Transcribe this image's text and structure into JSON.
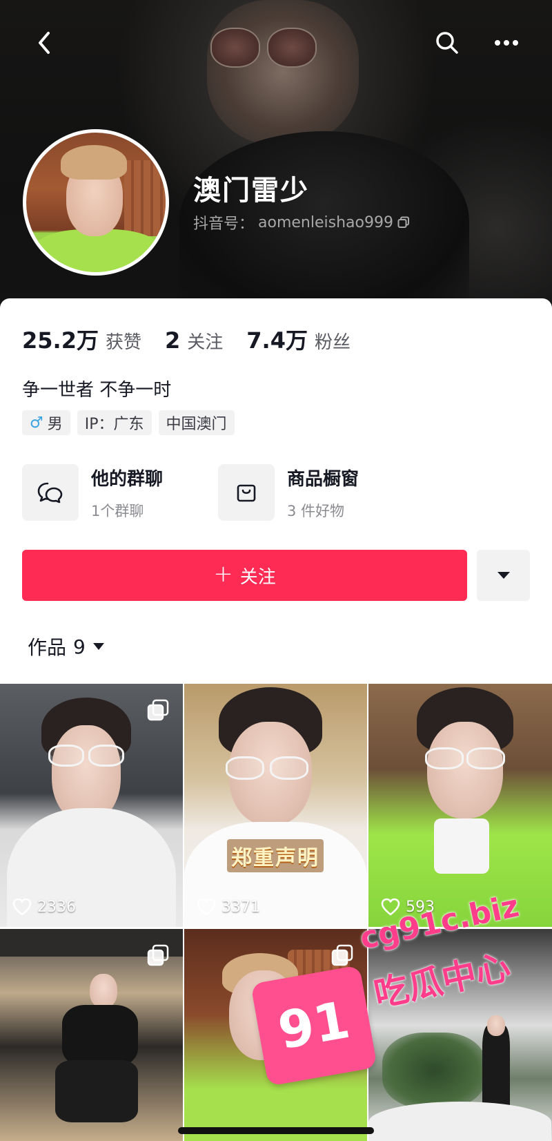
{
  "profile": {
    "name": "澳门雷少",
    "uid_label": "抖音号：",
    "uid": "aomenleishao999",
    "bio": "争一世者 不争一时"
  },
  "stats": [
    {
      "value": "25.2万",
      "label": "获赞"
    },
    {
      "value": "2",
      "label": "关注"
    },
    {
      "value": "7.4万",
      "label": "粉丝"
    }
  ],
  "tags": {
    "gender_symbol": "♂",
    "gender": "男",
    "ip": "IP：广东",
    "location": "中国澳门"
  },
  "features": {
    "group_chat": {
      "title": "他的群聊",
      "subtitle": "1个群聊",
      "icon": "chat-bubbles-icon"
    },
    "showcase": {
      "title": "商品橱窗",
      "subtitle": "3 件好物",
      "icon": "shopping-bag-icon"
    }
  },
  "follow": {
    "plus": "+",
    "label": "关注"
  },
  "works": {
    "label": "作品",
    "count": "9"
  },
  "videos": [
    {
      "likes": "2336",
      "multi": true
    },
    {
      "likes": "3371",
      "caption": "郑重声明"
    },
    {
      "likes": "593"
    },
    {
      "multi": true
    },
    {
      "multi": true
    },
    {}
  ],
  "watermark": {
    "url": "cg91c.biz",
    "text": "吃瓜中心",
    "badge": "91"
  },
  "colors": {
    "accent": "#fe2c55",
    "gender": "#3ba4e0",
    "watermark": "#ff3d8b"
  }
}
